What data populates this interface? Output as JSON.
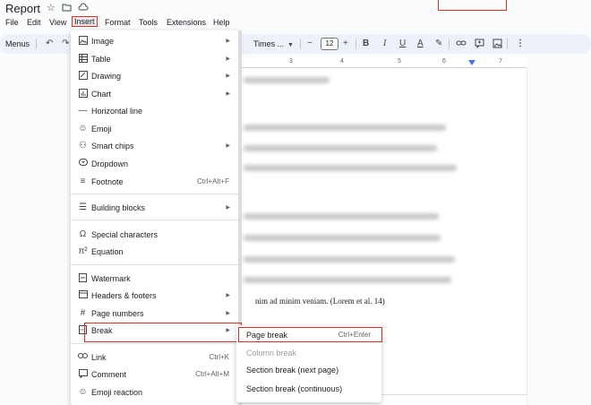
{
  "title_bar": {
    "doc_title": "Report",
    "icons": [
      "star-icon",
      "move-to-folder-icon",
      "cloud-status-icon"
    ]
  },
  "menubar": {
    "items": [
      "File",
      "Edit",
      "View",
      "Insert",
      "Format",
      "Tools",
      "Extensions",
      "Help"
    ],
    "active": "Insert"
  },
  "toolbar": {
    "menus_label": "Menus",
    "font_name": "Times ...",
    "font_size": "12",
    "icons": [
      "undo-icon",
      "redo-icon",
      "decrease-font-icon",
      "increase-font-icon",
      "bold-icon",
      "italic-icon",
      "underline-icon",
      "text-color-icon",
      "highlight-icon",
      "link-icon",
      "comment-icon",
      "image-icon",
      "more-icon"
    ],
    "glyphs": {
      "bold": "B",
      "italic": "I",
      "underline": "U",
      "text_color": "A",
      "minus": "−",
      "plus": "+"
    }
  },
  "ruler": {
    "numbers": [
      "3",
      "4",
      "5",
      "6",
      "7"
    ]
  },
  "insert_menu": {
    "items": [
      {
        "label": "Image",
        "icon": "image-icon",
        "submenu": true
      },
      {
        "label": "Table",
        "icon": "table-icon",
        "submenu": true
      },
      {
        "label": "Drawing",
        "icon": "drawing-icon",
        "submenu": true
      },
      {
        "label": "Chart",
        "icon": "chart-icon",
        "submenu": true
      },
      {
        "label": "Horizontal line",
        "icon": "horizontal-line-icon",
        "submenu": false
      },
      {
        "label": "Emoji",
        "icon": "emoji-icon",
        "submenu": false
      },
      {
        "label": "Smart chips",
        "icon": "smart-chips-icon",
        "submenu": true
      },
      {
        "label": "Dropdown",
        "icon": "dropdown-icon",
        "submenu": false
      },
      {
        "label": "Footnote",
        "icon": "footnote-icon",
        "shortcut": "Ctrl+Alt+F"
      },
      {
        "label": "Building blocks",
        "icon": "building-blocks-icon",
        "submenu": true
      },
      {
        "label": "Special characters",
        "icon": "omega-icon",
        "submenu": false
      },
      {
        "label": "Equation",
        "icon": "pi-icon",
        "submenu": false
      },
      {
        "label": "Watermark",
        "icon": "watermark-icon",
        "submenu": false
      },
      {
        "label": "Headers & footers",
        "icon": "headers-footers-icon",
        "submenu": true
      },
      {
        "label": "Page numbers",
        "icon": "hash-icon",
        "submenu": true
      },
      {
        "label": "Break",
        "icon": "break-icon",
        "submenu": true
      },
      {
        "label": "Link",
        "icon": "link-icon",
        "shortcut": "Ctrl+K"
      },
      {
        "label": "Comment",
        "icon": "comment-icon",
        "shortcut": "Ctrl+Alt+M"
      },
      {
        "label": "Emoji reaction",
        "icon": "emoji-reaction-icon",
        "submenu": false
      }
    ]
  },
  "break_submenu": {
    "items": [
      {
        "label": "Page break",
        "shortcut": "Ctrl+Enter",
        "disabled": false
      },
      {
        "label": "Column break",
        "disabled": true
      },
      {
        "label": "Section break (next page)",
        "disabled": false
      },
      {
        "label": "Section break (continuous)",
        "disabled": false
      }
    ]
  },
  "document": {
    "visible_text": "nim ad minim veniam.  (Lorem et al. 14)"
  },
  "colors": {
    "highlight_box": "#d93025",
    "toolbar_bg": "#edf2fa",
    "page_bg": "#f9fbfd"
  }
}
